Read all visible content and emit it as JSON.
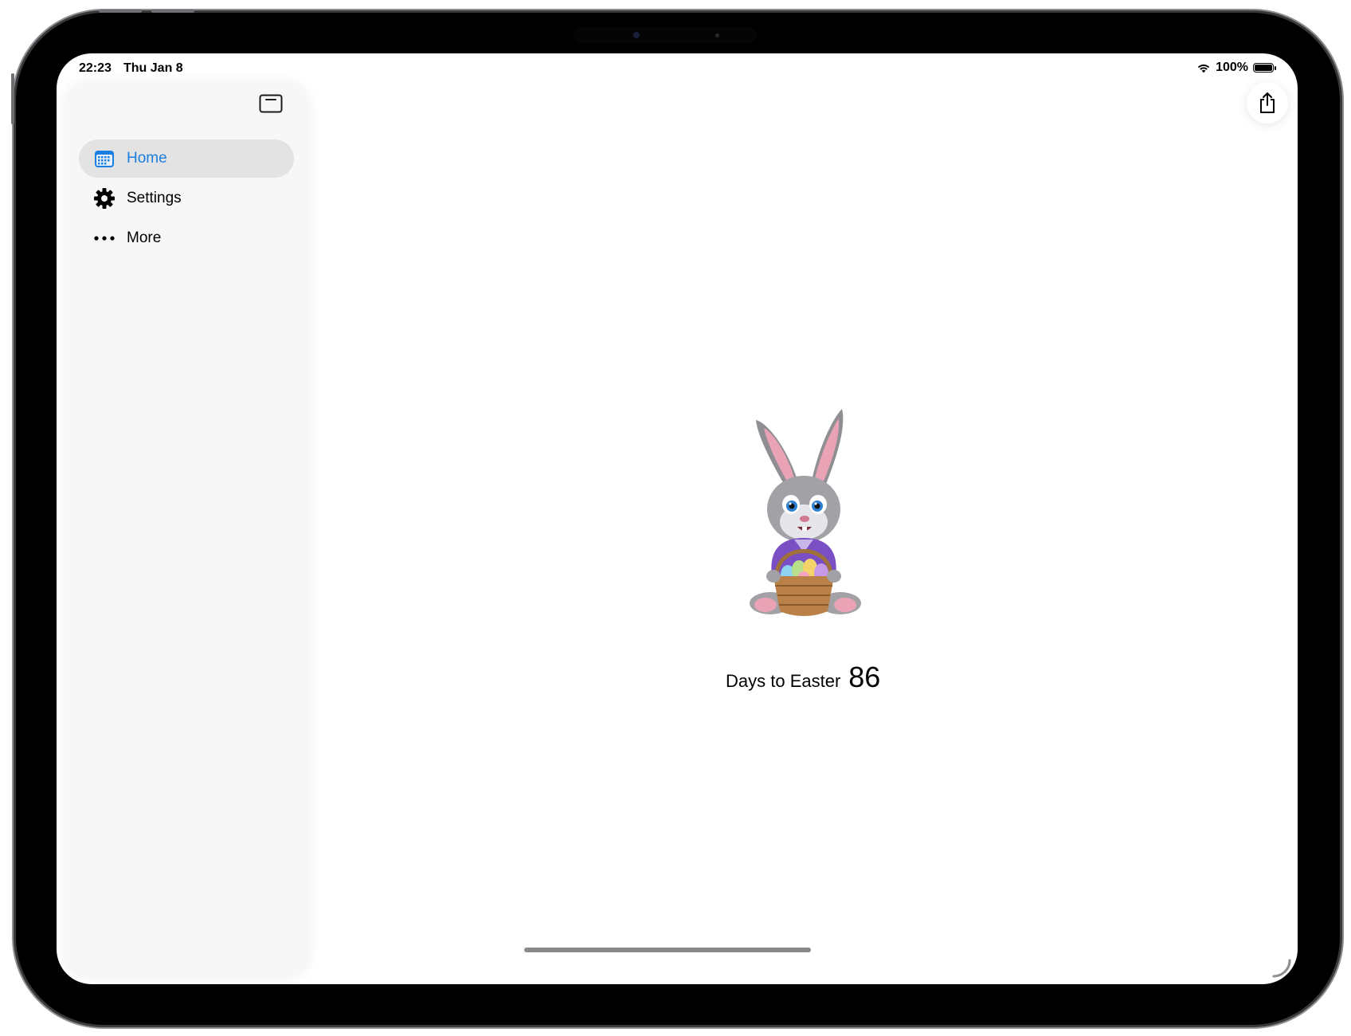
{
  "status_bar": {
    "time": "22:23",
    "date": "Thu Jan 8",
    "battery": "100%"
  },
  "sidebar": {
    "toggle_icon": "sidebar-toggle-icon",
    "items": [
      {
        "label": "Home",
        "icon": "calendar-icon",
        "selected": true
      },
      {
        "label": "Settings",
        "icon": "gear-icon",
        "selected": false
      },
      {
        "label": "More",
        "icon": "ellipsis-icon",
        "selected": false
      }
    ]
  },
  "toolbar": {
    "share_icon": "share-icon"
  },
  "main": {
    "illustration": "easter-bunny-illustration",
    "countdown_label": "Days to Easter",
    "countdown_value": "86"
  },
  "colors": {
    "accent": "#1a7fe0",
    "selected_bg": "#e3e3e3",
    "sidebar_bg": "#f7f7f7"
  }
}
